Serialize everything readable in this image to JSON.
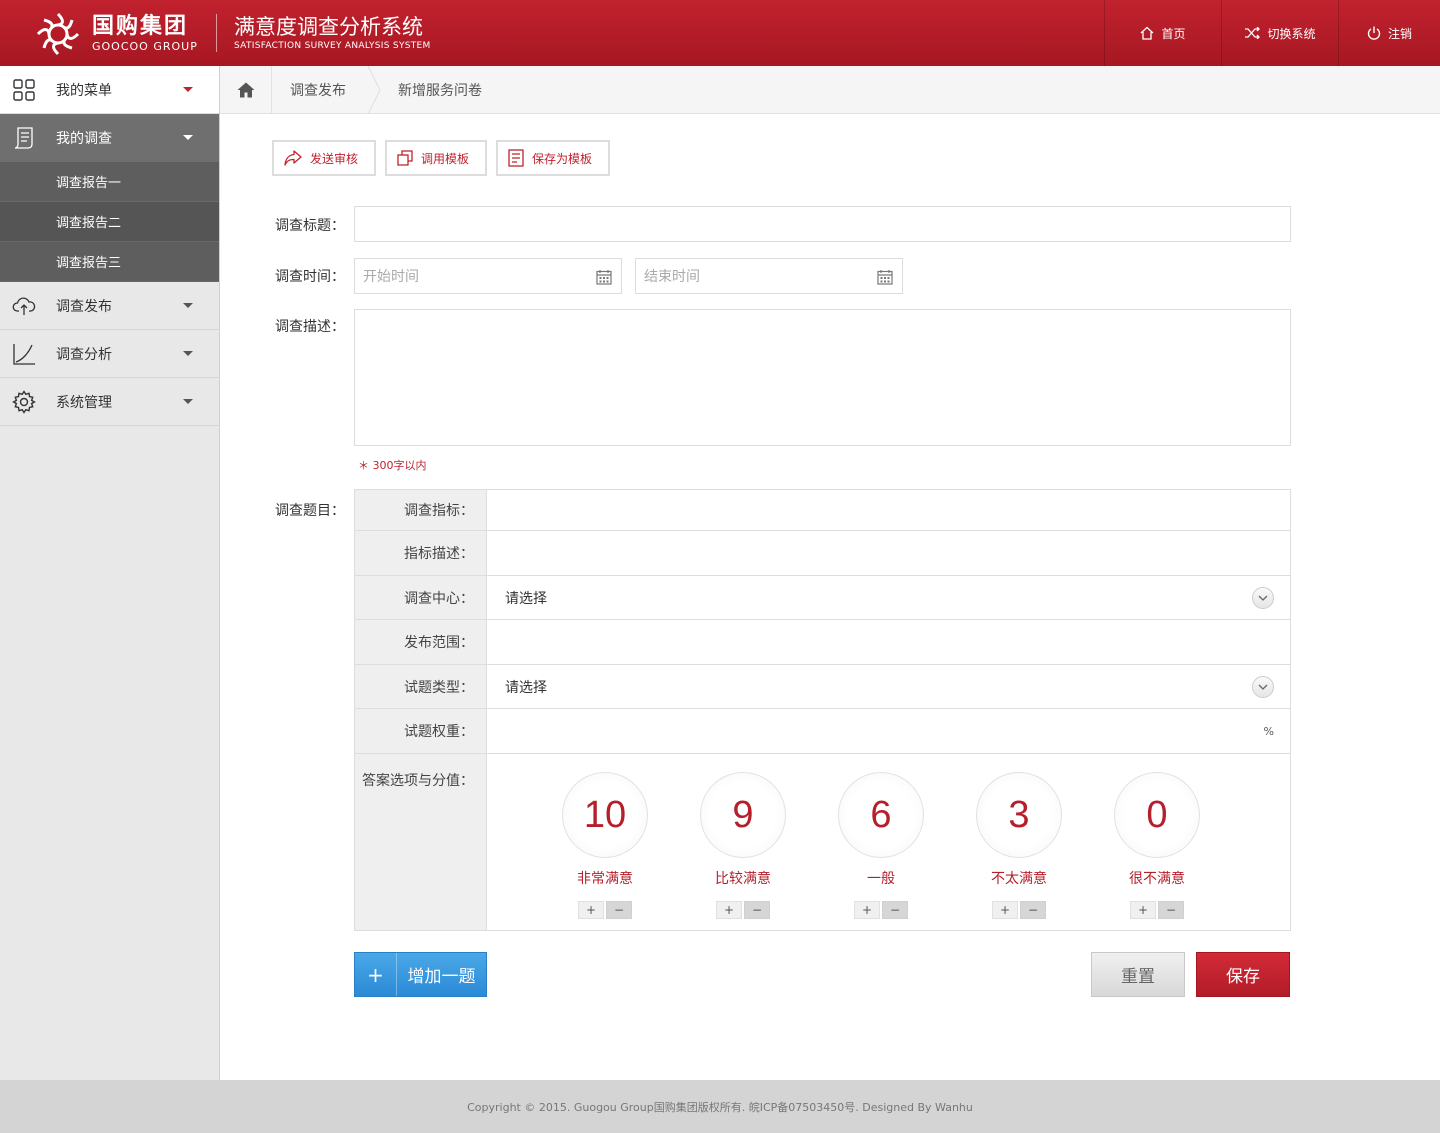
{
  "header": {
    "logo_cn": "国购集团",
    "logo_en": "GOOCOO GROUP",
    "system_title_cn": "满意度调查分析系统",
    "system_title_en": "SATISFACTION SURVEY ANALYSIS SYSTEM",
    "nav": [
      {
        "label": "首页",
        "icon": "home-icon"
      },
      {
        "label": "切换系统",
        "icon": "shuffle-icon"
      },
      {
        "label": "注销",
        "icon": "power-icon"
      }
    ]
  },
  "sidebar": {
    "menu_label": "我的菜单",
    "items": [
      {
        "label": "我的调查",
        "icon": "document-icon",
        "active": true
      },
      {
        "label": "调查发布",
        "icon": "cloud-upload-icon"
      },
      {
        "label": "调查分析",
        "icon": "chart-icon"
      },
      {
        "label": "系统管理",
        "icon": "gear-icon"
      }
    ],
    "sub_items": [
      "调查报告一",
      "调查报告二",
      "调查报告三"
    ]
  },
  "breadcrumb": [
    "调查发布",
    "新增服务问卷"
  ],
  "toolbar": {
    "send_review": "发送审核",
    "use_template": "调用模板",
    "save_template": "保存为模板"
  },
  "form": {
    "title_label": "调查标题：",
    "title_value": "",
    "time_label": "调查时间：",
    "start_placeholder": "开始时间",
    "end_placeholder": "结束时间",
    "desc_label": "调查描述：",
    "desc_hint": "＊ 300字以内",
    "question_label": "调查题目："
  },
  "question": {
    "indicator_label": "调查指标：",
    "indicator_desc_label": "指标描述：",
    "center_label": "调查中心：",
    "center_value": "请选择",
    "scope_label": "发布范围：",
    "type_label": "试题类型：",
    "type_value": "请选择",
    "weight_label": "试题权重：",
    "weight_unit": "%",
    "answers_label": "答案选项与分值：",
    "answers": [
      {
        "score": "10",
        "label": "非常满意"
      },
      {
        "score": "9",
        "label": "比较满意"
      },
      {
        "score": "6",
        "label": "一般"
      },
      {
        "score": "3",
        "label": "不太满意"
      },
      {
        "score": "0",
        "label": "很不满意"
      }
    ],
    "plus": "+",
    "minus": "−"
  },
  "buttons": {
    "add_plus": "+",
    "add": "增加一题",
    "reset": "重置",
    "save": "保存"
  },
  "footer": "Copyright © 2015. Guogou Group国购集团版权所有. 皖ICP备07503450号. Designed By Wanhu",
  "colors": {
    "brand_red": "#c1222e",
    "accent_blue": "#2b8ad6"
  }
}
